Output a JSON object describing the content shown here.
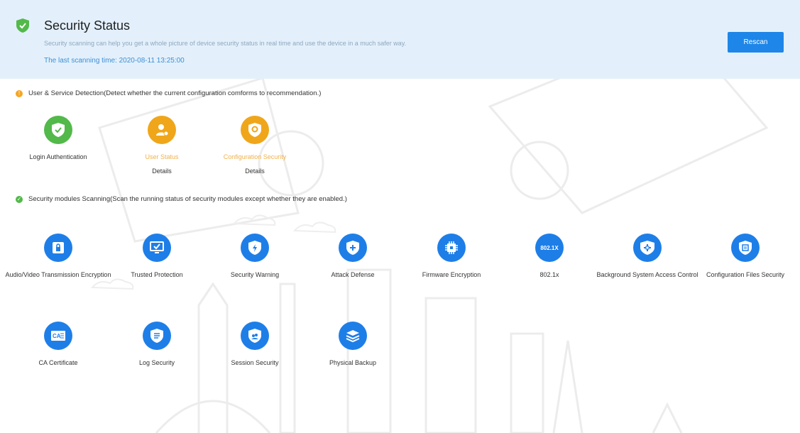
{
  "header": {
    "title": "Security Status",
    "description": "Security scanning can help you get a whole picture of device security status in real time and use the device in a much safer way.",
    "last_scan": "The last scanning time: 2020-08-11 13:25:00",
    "rescan_label": "Rescan"
  },
  "user_service": {
    "heading": "User & Service Detection(Detect whether the current configuration comforms to recommendation.)",
    "items": [
      {
        "label": "Login Authentication",
        "icon": "shield-check-icon",
        "status": "ok"
      },
      {
        "label": "User Status",
        "icon": "user-icon",
        "status": "warning",
        "details": "Details"
      },
      {
        "label": "Configuration Security",
        "icon": "config-shield-icon",
        "status": "warning",
        "details": "Details"
      }
    ]
  },
  "modules": {
    "heading": "Security modules Scanning(Scan the running status of security modules except whether they are enabled.)",
    "items": [
      {
        "label": "Audio/Video Transmission Encryption",
        "icon": "av-encryption-icon"
      },
      {
        "label": "Trusted Protection",
        "icon": "monitor-check-icon"
      },
      {
        "label": "Security Warning",
        "icon": "lightning-shield-icon"
      },
      {
        "label": "Attack Defense",
        "icon": "plus-shield-icon"
      },
      {
        "label": "Firmware Encryption",
        "icon": "chip-icon"
      },
      {
        "label": "802.1x",
        "icon": "802-1x-icon",
        "icon_text": "802.1X"
      },
      {
        "label": "Background System Access Control",
        "icon": "access-shield-icon"
      },
      {
        "label": "Configuration Files Security",
        "icon": "file-shield-icon"
      },
      {
        "label": "CA Certificate",
        "icon": "ca-certificate-icon",
        "icon_text": "CA"
      },
      {
        "label": "Log Security",
        "icon": "log-shield-icon"
      },
      {
        "label": "Session Security",
        "icon": "session-shield-icon"
      },
      {
        "label": "Physical Backup",
        "icon": "layers-icon"
      }
    ]
  },
  "colors": {
    "accent": "#1e86e8",
    "ok": "#52b94a",
    "warning": "#f0a61a",
    "module": "#1e7ee8"
  }
}
